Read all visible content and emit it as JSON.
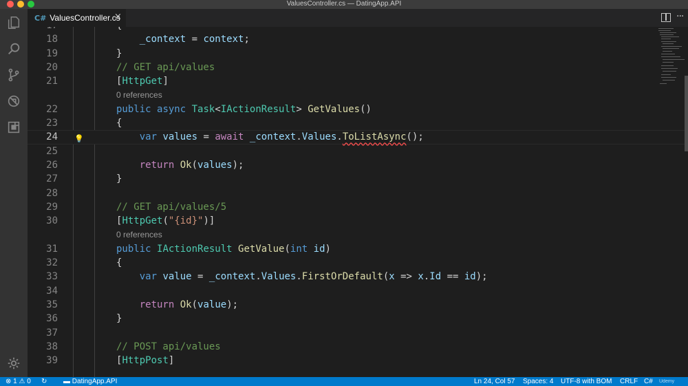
{
  "window": {
    "title": "ValuesController.cs — DatingApp.API"
  },
  "activity_bar": {
    "items": [
      {
        "icon": "files-icon"
      },
      {
        "icon": "search-icon"
      },
      {
        "icon": "source-control-icon"
      },
      {
        "icon": "debug-icon"
      },
      {
        "icon": "extensions-icon"
      }
    ],
    "settings_icon": "gear-icon"
  },
  "tabs": [
    {
      "icon_glyph": "C#",
      "label": "ValuesController.cs",
      "close": "×"
    }
  ],
  "editor": {
    "code_lens": "0 references",
    "lightbulb_line": "24"
  },
  "status_bar": {
    "errors": "1",
    "warnings": "0",
    "folder": "DatingApp.API",
    "position": "Ln 24, Col 57",
    "spaces": "Spaces: 4",
    "encoding": "UTF-8 with BOM",
    "eol": "CRLF",
    "language": "C#",
    "watermark": "Udemy"
  },
  "colors": {
    "keyword": "#569cd6",
    "control": "#c586c0",
    "type": "#4ec9b0",
    "function": "#dcdcaa",
    "variable": "#9cdcfe",
    "comment": "#6a9955",
    "string": "#ce9178",
    "status_bar": "#007acc"
  }
}
